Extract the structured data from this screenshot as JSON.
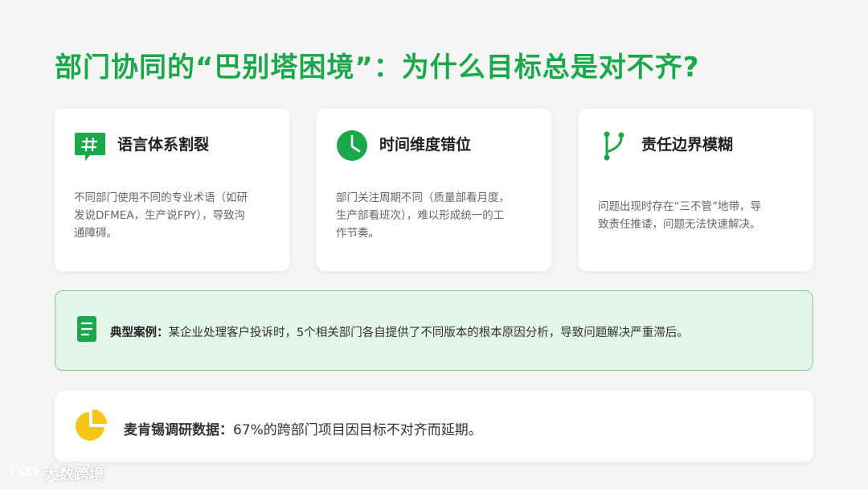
{
  "title": "部门协同的“巴别塔困境”：为什么目标总是对不齐?",
  "cards": [
    {
      "icon": "hashtag-chat-icon",
      "heading": "语言体系割裂",
      "body_lines": [
        "不同部门使用不同的专业术语（如研",
        "发说DFMEA，生产说FPY），导致沟",
        "通障碍。"
      ]
    },
    {
      "icon": "clock-icon",
      "heading": "时间维度错位",
      "body_lines": [
        "部门关注周期不同（质量部看月度，",
        "生产部看班次），难以形成统一的工",
        "作节奏。"
      ]
    },
    {
      "icon": "branch-icon",
      "heading": "责任边界模糊",
      "body_lines": [
        "问题出现时存在“三不管”地带，导",
        "致责任推诿，问题无法快速解决。"
      ]
    }
  ],
  "case": {
    "icon": "document-icon",
    "label": "典型案例：",
    "text": "某企业处理客户投诉时，5个相关部门各自提供了不同版本的根本原因分析，导致问题解决严重滞后。"
  },
  "data": {
    "icon": "pie-chart-icon",
    "label": "麦肯锡调研数据：",
    "text": "67%的跨部门项目因目标不对齐而延期。"
  },
  "watermark": {
    "icon": "logo-icon",
    "text": "大数跨境"
  },
  "colors": {
    "accent": "#1aa84a",
    "case_bg": "#e3f4e8",
    "case_border": "#7fce97",
    "pie": "#f5c518"
  }
}
